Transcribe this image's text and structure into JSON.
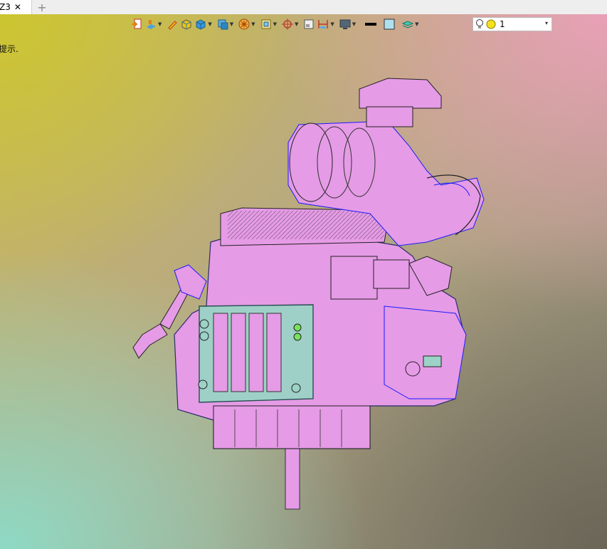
{
  "tab": {
    "label": "Z3",
    "close": "✕",
    "add": "+"
  },
  "prompt_text": "提示.",
  "toolbar": {
    "tools": [
      {
        "icon": "exit-sketch-icon",
        "caret": false
      },
      {
        "icon": "layer-paint-icon",
        "caret": true
      },
      {
        "icon": "pencil-icon",
        "caret": false
      },
      {
        "icon": "material-box-icon",
        "caret": false
      },
      {
        "icon": "solid-box-icon",
        "caret": true
      },
      {
        "icon": "view-cube-icon",
        "caret": true
      },
      {
        "icon": "wheel-render-icon",
        "caret": true
      },
      {
        "icon": "section-view-icon",
        "caret": true
      },
      {
        "icon": "crosshair-icon",
        "caret": true
      },
      {
        "icon": "frame-icon",
        "caret": false
      },
      {
        "icon": "dimension-icon",
        "caret": true
      },
      {
        "icon": "monitor-icon",
        "caret": true
      },
      {
        "icon": "line-color-icon",
        "caret": false
      },
      {
        "icon": "fill-color-icon",
        "caret": false
      },
      {
        "icon": "layers-icon",
        "caret": true
      }
    ],
    "layer_value": "1",
    "layer_dropdown": "▾"
  },
  "colors": {
    "part_pink": "#e59be6",
    "edge_blue": "#1a1aff",
    "part_teal": "#9cd3c6",
    "bulb_yellow": "#f5e21c"
  }
}
